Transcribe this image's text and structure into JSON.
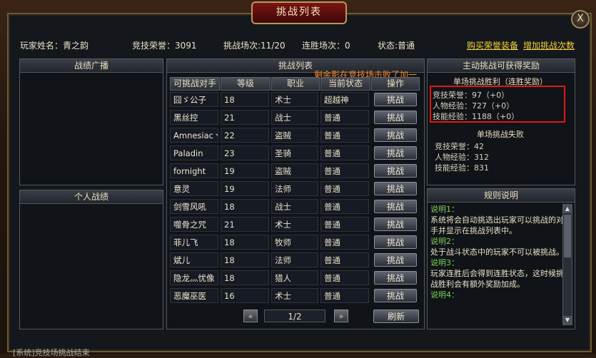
{
  "window": {
    "title": "挑战列表",
    "close": "X"
  },
  "info": {
    "player_name": "玩家姓名：青之韵",
    "honor": "竞技荣誉：3091",
    "challenges": "挑战场次:11/20",
    "win_streak": "连胜场次：0",
    "status": "状态:普通",
    "buy_link": "购买荣誉装备",
    "add_link": "增加挑战次数"
  },
  "left": {
    "battle_broadcast": "战绩广播",
    "personal_record": "个人战绩"
  },
  "center": {
    "title": "挑战列表",
    "notice": "剩余影在竞技场击败了加一",
    "headers": [
      "可挑战对手",
      "等级",
      "职业",
      "当前状态",
      "操作"
    ],
    "rows": [
      {
        "name": "囧ゞ公子",
        "level": "18",
        "class": "术士",
        "status": "超越神",
        "action": "挑战"
      },
      {
        "name": "黑丝控",
        "level": "21",
        "class": "战士",
        "status": "普通",
        "action": "挑战"
      },
      {
        "name": "Amnesiacヽ",
        "level": "22",
        "class": "盗贼",
        "status": "普通",
        "action": "挑战"
      },
      {
        "name": "Paladin",
        "level": "23",
        "class": "圣骑",
        "status": "普通",
        "action": "挑战"
      },
      {
        "name": "fornight",
        "level": "19",
        "class": "盗贼",
        "status": "普通",
        "action": "挑战"
      },
      {
        "name": "意灵",
        "level": "19",
        "class": "法师",
        "status": "普通",
        "action": "挑战"
      },
      {
        "name": "剑雪风吼",
        "level": "18",
        "class": "战士",
        "status": "普通",
        "action": "挑战"
      },
      {
        "name": "噬骨之咒",
        "level": "21",
        "class": "术士",
        "status": "普通",
        "action": "挑战"
      },
      {
        "name": "菲儿飞",
        "level": "18",
        "class": "牧师",
        "status": "普通",
        "action": "挑战"
      },
      {
        "name": "斌儿",
        "level": "18",
        "class": "法师",
        "status": "普通",
        "action": "挑战"
      },
      {
        "name": "隐龙灬忧像",
        "level": "18",
        "class": "猎人",
        "status": "普通",
        "action": "挑战"
      },
      {
        "name": "恶魔巫医",
        "level": "16",
        "class": "术士",
        "status": "普通",
        "action": "挑战"
      }
    ],
    "pager": {
      "prev": "«",
      "page": "1/2",
      "next": "»",
      "refresh": "刷新"
    }
  },
  "right": {
    "reward_title": "主动挑战可获得奖励",
    "win_title": "单场挑战胜利（连胜奖励）",
    "win_lines": [
      "竞技荣誉：97（+0）",
      "人物经验：727（+0）",
      "技能经验：1188（+0）"
    ],
    "lose_title": "单场挑战失败",
    "lose_lines": [
      "竞技荣誉：42",
      "人物经验：312",
      "技能经验：831"
    ],
    "rules_title": "规则说明",
    "rules": [
      {
        "label": "说明1：",
        "text": "系统将会自动挑选出玩家可以挑战的对手并显示在挑战列表中。"
      },
      {
        "label": "说明2：",
        "text": "处于战斗状态中的玩家不可以被挑战。"
      },
      {
        "label": "说明3：",
        "text": "玩家连胜后会得到连胜状态，这时候挑战胜利会有额外奖励加成。"
      },
      {
        "label": "说明4：",
        "text": ""
      }
    ]
  },
  "bottom_text": "[系统]竞技场挑战结束"
}
